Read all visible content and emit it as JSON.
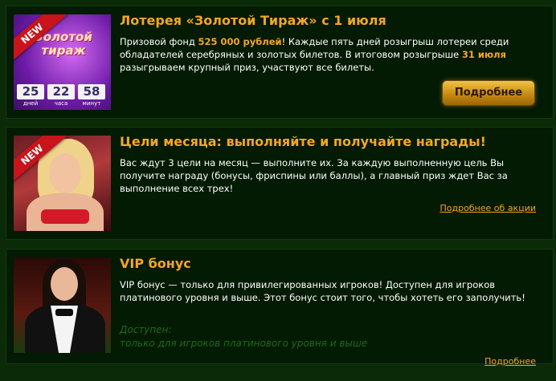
{
  "promos": [
    {
      "badge": "NEW",
      "title": "Лотерея «Золотой Тираж» с 1 июля",
      "desc": {
        "p1": "Призовой фонд ",
        "prize": "525 000 рублей",
        "p2": "! Каждые пять дней розыгрыш лотереи среди обладателей серебряных и золотых билетов. В итоговом розыгрыше ",
        "date": "31 июля",
        "p3": " разыгрываем крупный приз, участвуют все билеты."
      },
      "thumb": {
        "logo_line1": "Золотой",
        "logo_line2": "тираж",
        "timer": [
          {
            "value": "25",
            "label": "дней"
          },
          {
            "value": "22",
            "label": "часа"
          },
          {
            "value": "58",
            "label": "минут"
          }
        ]
      },
      "button": "Подробнее"
    },
    {
      "badge": "NEW",
      "title": "Цели месяца: выполняйте и получайте награды!",
      "desc": "Вас ждут 3 цели на месяц — выполните их. За каждую выполненную цель Вы получите награду (бонусы, фриспины или баллы), а главный приз ждет Вас за выполнение всех трех!",
      "link": "Подробнее об акции"
    },
    {
      "title": "VIP бонус",
      "desc": "VIP бонус — только для привилегированных игроков! Доступен для игроков платинового уровня и выше. Этот бонус стоит того, чтобы хотеть его заполучить!",
      "avail_label": "Доступен:",
      "avail_text": "только для игроков платинового уровня и выше",
      "link": "Подробнее"
    }
  ],
  "colors": {
    "accent": "#f5a623",
    "background": "#0a2a08",
    "card": "#031a03",
    "ribbon": "#c8141a",
    "avail_text": "#1f6a17"
  }
}
